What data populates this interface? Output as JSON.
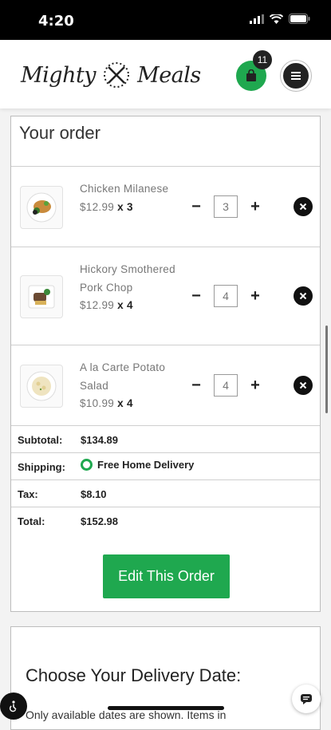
{
  "status_bar": {
    "time": "4:20"
  },
  "header": {
    "logo_left": "Mighty",
    "logo_right": "Meals",
    "cart_count": "11"
  },
  "order": {
    "title": "Your order",
    "items": [
      {
        "name": "Chicken Milanese",
        "price": "$12.99",
        "multiplier": "x 3",
        "qty": "3"
      },
      {
        "name": "Hickory Smothered Pork Chop",
        "price": "$12.99",
        "multiplier": "x 4",
        "qty": "4"
      },
      {
        "name": "A la Carte Potato Salad",
        "price": "$10.99",
        "multiplier": "x 4",
        "qty": "4"
      }
    ],
    "minus_label": "−",
    "plus_label": "+",
    "totals": {
      "subtotal_label": "Subtotal:",
      "subtotal": "$134.89",
      "shipping_label": "Shipping:",
      "shipping": "Free Home Delivery",
      "tax_label": "Tax:",
      "tax": "$8.10",
      "total_label": "Total:",
      "total": "$152.98"
    },
    "edit_button": "Edit This Order"
  },
  "delivery": {
    "title": "Choose Your Delivery Date:",
    "subtitle": "Only available dates are shown. Items in"
  },
  "colors": {
    "accent": "#1fa84f",
    "dark": "#222222"
  }
}
